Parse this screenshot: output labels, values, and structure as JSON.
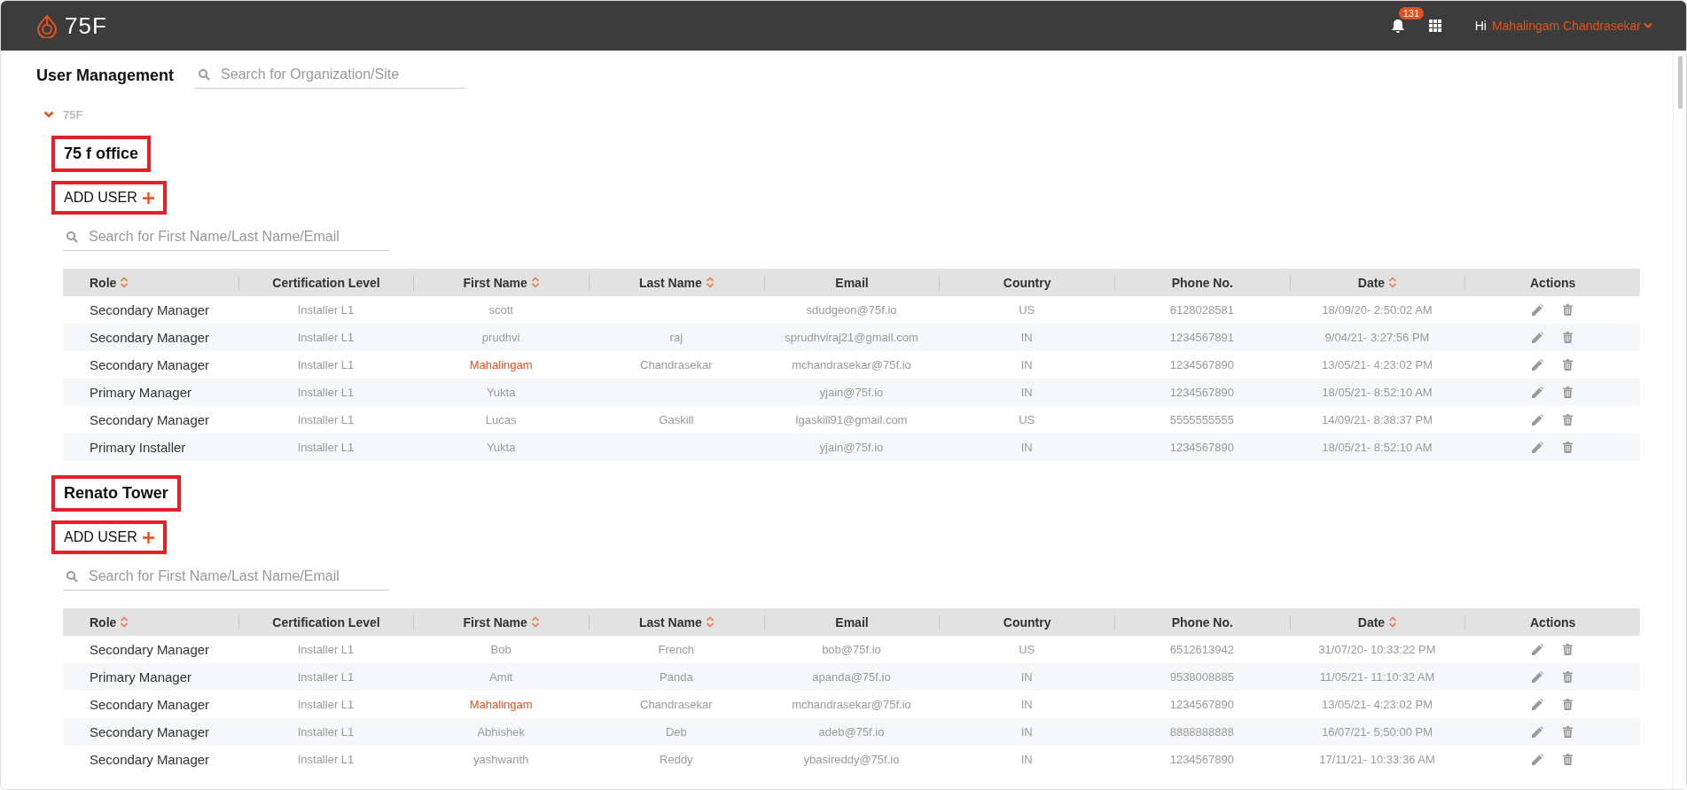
{
  "header": {
    "logo_text": "75F",
    "notification_count": "131",
    "greeting": "Hi",
    "user_name": "Mahalingam Chandrasekar"
  },
  "page_title": "User Management",
  "org_search": {
    "placeholder": "Search for Organization/Site"
  },
  "tree": {
    "label": "75F",
    "expanded": true
  },
  "sites": [
    {
      "name": "75 f office",
      "marked": true,
      "add_button": "ADD USER",
      "search": {
        "placeholder": "Search for First Name/Last Name/Email"
      },
      "columns": [
        {
          "label": "Role",
          "sortable": true
        },
        {
          "label": "Certification Level",
          "sortable": false
        },
        {
          "label": "First Name",
          "sortable": true
        },
        {
          "label": "Last Name",
          "sortable": true
        },
        {
          "label": "Email",
          "sortable": false
        },
        {
          "label": "Country",
          "sortable": false
        },
        {
          "label": "Phone No.",
          "sortable": false
        },
        {
          "label": "Date",
          "sortable": true
        },
        {
          "label": "Actions",
          "sortable": false
        }
      ],
      "rows": [
        {
          "role": "Secondary Manager",
          "certification": "Installer L1",
          "first_name": "scott",
          "last_name": "",
          "email": "sdudgeon@75f.io",
          "country": "US",
          "phone": "6128028581",
          "date": "18/09/20- 2:50:02 AM",
          "current_user": false
        },
        {
          "role": "Secondary Manager",
          "certification": "Installer L1",
          "first_name": "prudhvi",
          "last_name": "raj",
          "email": "sprudhviraj21@gmail.com",
          "country": "IN",
          "phone": "1234567891",
          "date": "9/04/21- 3:27:56 PM",
          "current_user": false
        },
        {
          "role": "Secondary Manager",
          "certification": "Installer L1",
          "first_name": "Mahalingam",
          "last_name": "Chandrasekar",
          "email": "mchandrasekar@75f.io",
          "country": "IN",
          "phone": "1234567890",
          "date": "13/05/21- 4:23:02 PM",
          "current_user": true
        },
        {
          "role": "Primary Manager",
          "certification": "Installer L1",
          "first_name": "Yukta",
          "last_name": "",
          "email": "yjain@75f.io",
          "country": "IN",
          "phone": "1234567890",
          "date": "18/05/21- 8:52:10 AM",
          "current_user": false
        },
        {
          "role": "Secondary Manager",
          "certification": "Installer L1",
          "first_name": "Lucas",
          "last_name": "Gaskill",
          "email": "lgaskill91@gmail.com",
          "country": "US",
          "phone": "5555555555",
          "date": "14/09/21- 8:38:37 PM",
          "current_user": false
        },
        {
          "role": "Primary Installer",
          "certification": "Installer L1",
          "first_name": "Yukta",
          "last_name": "",
          "email": "yjain@75f.io",
          "country": "IN",
          "phone": "1234567890",
          "date": "18/05/21- 8:52:10 AM",
          "current_user": false
        }
      ]
    },
    {
      "name": "Renato Tower",
      "marked": true,
      "add_button": "ADD USER",
      "search": {
        "placeholder": "Search for First Name/Last Name/Email"
      },
      "columns": [
        {
          "label": "Role",
          "sortable": true
        },
        {
          "label": "Certification Level",
          "sortable": false
        },
        {
          "label": "First Name",
          "sortable": true
        },
        {
          "label": "Last Name",
          "sortable": true
        },
        {
          "label": "Email",
          "sortable": false
        },
        {
          "label": "Country",
          "sortable": false
        },
        {
          "label": "Phone No.",
          "sortable": false
        },
        {
          "label": "Date",
          "sortable": true
        },
        {
          "label": "Actions",
          "sortable": false
        }
      ],
      "rows": [
        {
          "role": "Secondary Manager",
          "certification": "Installer L1",
          "first_name": "Bob",
          "last_name": "French",
          "email": "bob@75f.io",
          "country": "US",
          "phone": "6512613942",
          "date": "31/07/20- 10:33:22 PM",
          "current_user": false
        },
        {
          "role": "Primary Manager",
          "certification": "Installer L1",
          "first_name": "Amit",
          "last_name": "Panda",
          "email": "apanda@75f.io",
          "country": "IN",
          "phone": "9538008885",
          "date": "11/05/21- 11:10:32 AM",
          "current_user": false
        },
        {
          "role": "Secondary Manager",
          "certification": "Installer L1",
          "first_name": "Mahalingam",
          "last_name": "Chandrasekar",
          "email": "mchandrasekar@75f.io",
          "country": "IN",
          "phone": "1234567890",
          "date": "13/05/21- 4:23:02 PM",
          "current_user": true
        },
        {
          "role": "Secondary Manager",
          "certification": "Installer L1",
          "first_name": "Abhishek",
          "last_name": "Deb",
          "email": "adeb@75f.io",
          "country": "IN",
          "phone": "8888888888",
          "date": "16/07/21- 5:50:00 PM",
          "current_user": false
        },
        {
          "role": "Secondary Manager",
          "certification": "Installer L1",
          "first_name": "yashwanth",
          "last_name": "Reddy",
          "email": "ybasireddy@75f.io",
          "country": "IN",
          "phone": "1234567890",
          "date": "17/11/21- 10:33:36 AM",
          "current_user": false
        }
      ]
    }
  ]
}
